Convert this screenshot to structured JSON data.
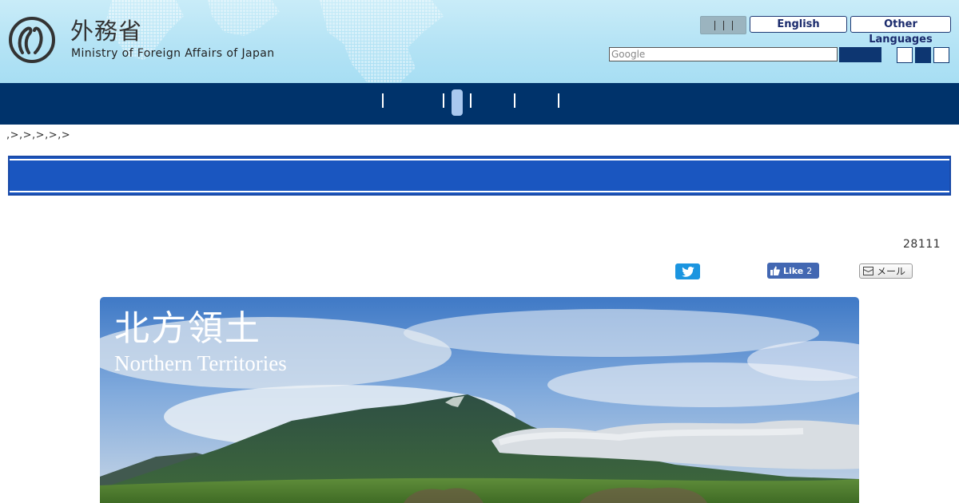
{
  "header": {
    "logo_jp": "外務省",
    "logo_en": "Ministry of Foreign Affairs of Japan",
    "lang_english": "English",
    "lang_other": "Other Languages",
    "search_placeholder": "Google"
  },
  "breadcrumb": ",>,>,>,>,>",
  "doc_number": "28111",
  "share": {
    "facebook_label": "Like",
    "facebook_count": "2",
    "mail_label": "メール"
  },
  "banner": {
    "title_jp": "北方領土",
    "title_en": "Northern Territories"
  },
  "colors": {
    "nav_bg": "#00336b",
    "title_bar_bg": "#1a56c0",
    "twitter": "#1b95e0",
    "facebook": "#4267b2"
  },
  "icons": [
    "mofa-logo-icon",
    "twitter-icon",
    "thumbs-up-icon",
    "mail-icon"
  ]
}
